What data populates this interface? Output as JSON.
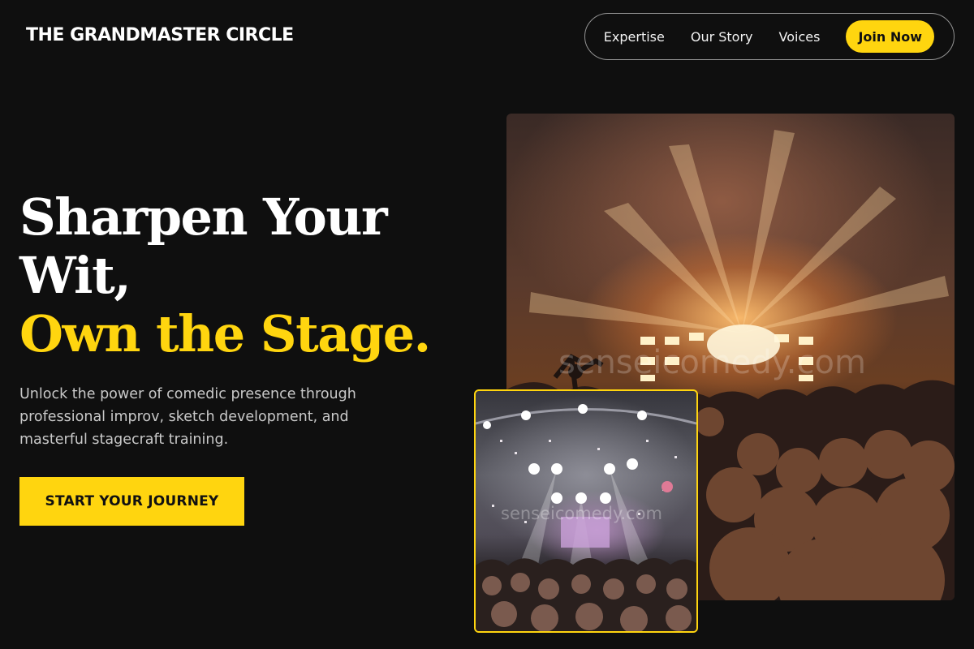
{
  "header": {
    "logo": "THE GRANDMASTER CIRCLE",
    "nav": [
      {
        "label": "Expertise"
      },
      {
        "label": "Our Story"
      },
      {
        "label": "Voices"
      }
    ],
    "cta_label": "Join Now"
  },
  "hero": {
    "headline_line1": "Sharpen Your",
    "headline_line2": "Wit,",
    "headline_accent": "Own the Stage.",
    "subtext": "Unlock the power of comedic presence through professional improv, sketch development, and masterful stagecraft training.",
    "cta_label": "START YOUR JOURNEY"
  },
  "images": {
    "main_watermark": "senseicomedy.com",
    "inset_watermark": "senseicomedy.com"
  },
  "colors": {
    "background": "#0f0f0f",
    "accent": "#ffd50f",
    "text": "#ffffff",
    "muted_text": "#c9c9c9"
  }
}
